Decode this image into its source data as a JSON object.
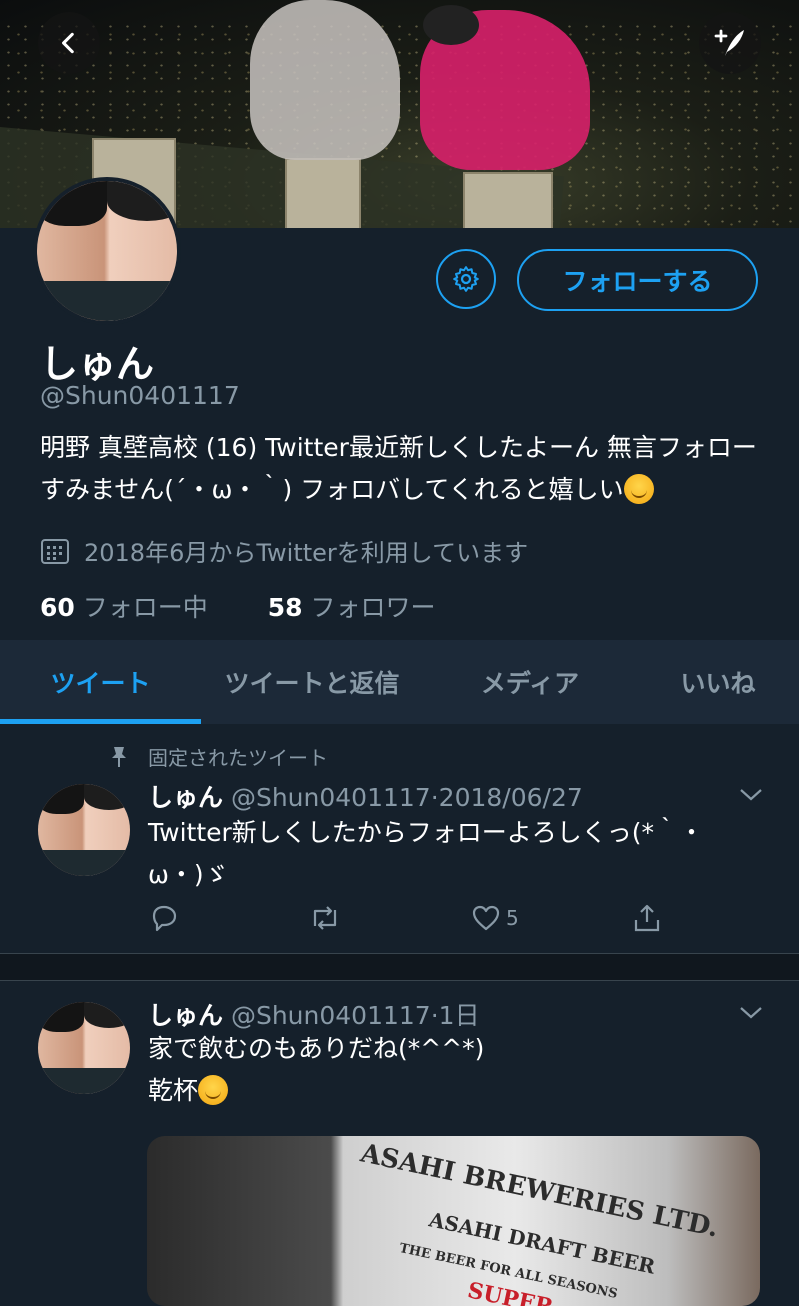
{
  "profile": {
    "name": "しゅん",
    "handle": "@Shun0401117",
    "bio": "明野 真壁高校 (16) Twitter最近新しくしたよーん 無言フォローすみません(´・ω・｀) フォロバしてくれると嬉しい",
    "bio_emoji": "smiling-face-emoji",
    "joined": "2018年6月からTwitterを利用しています",
    "following_count": "60",
    "following_label": "フォロー中",
    "followers_count": "58",
    "followers_label": "フォロワー"
  },
  "buttons": {
    "back_icon": "back-arrow-icon",
    "compose_icon": "compose-tweet-icon",
    "settings_icon": "gear-icon",
    "follow_label": "フォローする"
  },
  "tabs": [
    {
      "label": "ツイート",
      "active": true
    },
    {
      "label": "ツイートと返信",
      "active": false
    },
    {
      "label": "メディア",
      "active": false
    },
    {
      "label": "いいね",
      "active": false
    }
  ],
  "tweets": [
    {
      "pinned_label": "固定されたツイート",
      "name": "しゅん",
      "handle": "@Shun0401117",
      "separator": "·",
      "time": "2018/06/27",
      "text_line1": "Twitter新しくしたからフォローよろしくっ(*｀・",
      "text_line2": "ω・)ゞ",
      "like_count": "5"
    },
    {
      "name": "しゅん",
      "handle": "@Shun0401117",
      "separator": "·",
      "time": "1日",
      "text_line1": "家で飲むのもありだね(*^^*)",
      "text_line2": "乾杯",
      "media_text": [
        "ASAHI BREWERIES LTD.",
        "ASAHI DRAFT BEER",
        "THE BEER FOR ALL SEASONS",
        "SUPER"
      ]
    }
  ],
  "colors": {
    "background": "#15202b",
    "accent": "#1da1f2",
    "secondary_text": "#8899a6",
    "tabbar": "#1c2938"
  }
}
